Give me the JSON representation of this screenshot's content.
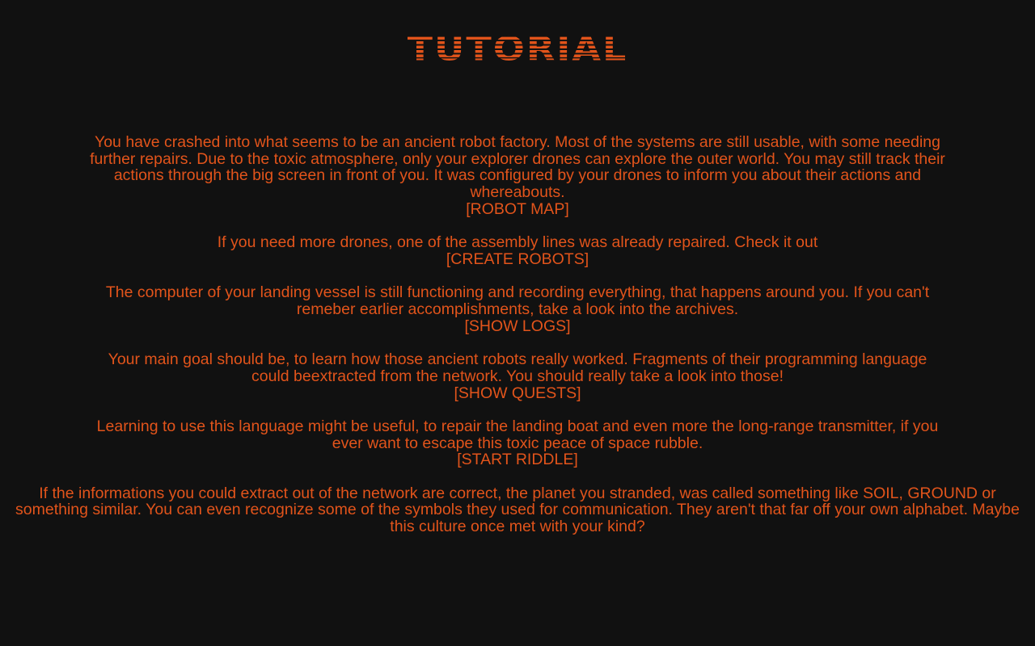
{
  "title": "TUTORIAL",
  "sections": [
    {
      "text": "You have crashed into what seems to be an ancient robot factory. Most of the systems are still usable, with some needing further repairs. Due to the toxic atmosphere, only your explorer drones can explore the outer world. You may still track their actions through the big screen in front of you. It was configured by your drones to inform you about their actions and whereabouts.",
      "link": "[ROBOT MAP]"
    },
    {
      "text": "If you need more drones, one of the assembly lines was already repaired. Check it out",
      "link": "[CREATE ROBOTS]"
    },
    {
      "text": "The computer of your landing vessel is still functioning and recording everything, that happens around you. If you can't remeber earlier accomplishments, take a look into the archives.",
      "link": "[SHOW LOGS]"
    },
    {
      "text": "Your main goal should be, to learn how those ancient robots really worked. Fragments of their programming language could beextracted from the network. You should really take a look into those!",
      "link": "[SHOW QUESTS]"
    },
    {
      "text": "Learning to use this language might be useful, to repair the landing boat and even more the long-range transmitter, if you ever want to escape this toxic peace of space rubble.",
      "link": "[START RIDDLE]"
    },
    {
      "text": "If the informations you could extract out of the network are correct, the planet you stranded, was called something like SOIL, GROUND or something similar. You can even recognize some of the symbols they used for communication. They aren't that far off your own alphabet. Maybe this culture once met with your kind?"
    }
  ],
  "colors": {
    "background": "#111111",
    "accent": "#e2541b"
  }
}
